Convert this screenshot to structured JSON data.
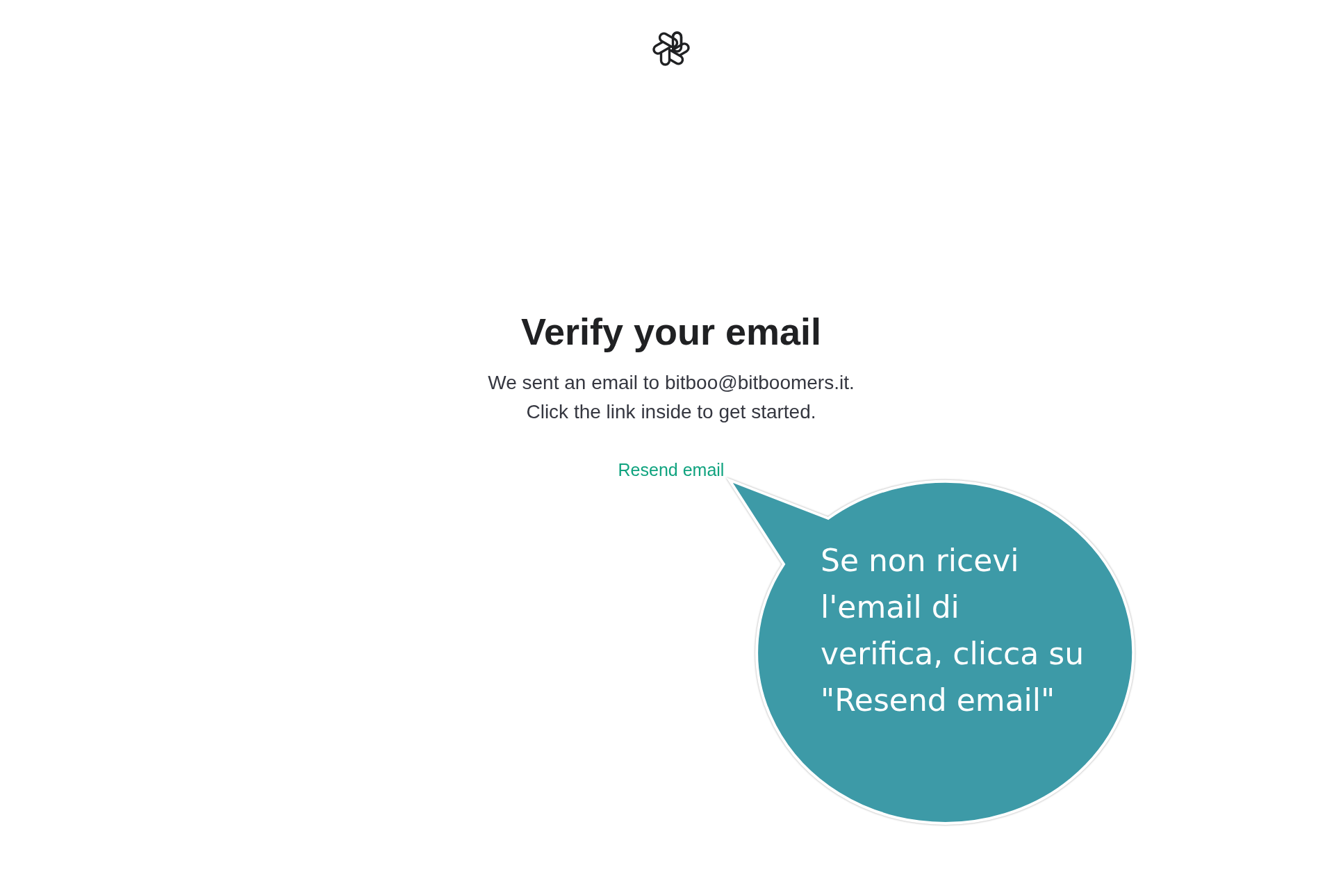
{
  "heading": "Verify your email",
  "message": "We sent an email to bitboo@bitboomers.it. Click the link inside to get started.",
  "resend_link": "Resend email",
  "callout": {
    "text": "Se non ricevi l'email di verifica, clicca su \"Resend email\""
  }
}
